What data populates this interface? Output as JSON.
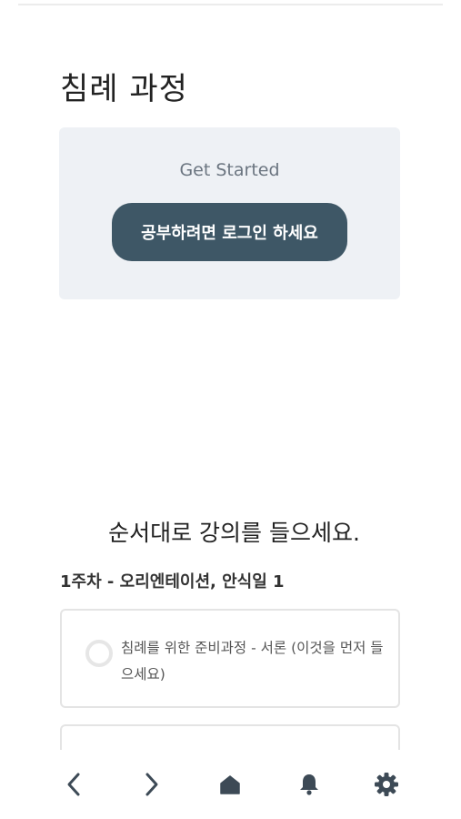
{
  "course": {
    "title": "침례 과정"
  },
  "cta": {
    "heading": "Get Started",
    "button_label": "공부하려면 로그인 하세요"
  },
  "instructions": "순서대로 강의를 들으세요.",
  "week": {
    "title": "1주차 - 오리엔테이션, 안식일 1",
    "lessons": [
      {
        "title": "침례를 위한 준비과정 - 서론 (이것을 먼저 들으세요)",
        "completed": false
      }
    ]
  },
  "bottom_nav": {
    "items": [
      {
        "name": "back",
        "icon": "chevron-left-icon"
      },
      {
        "name": "forward",
        "icon": "chevron-right-icon"
      },
      {
        "name": "home",
        "icon": "home-icon"
      },
      {
        "name": "notifications",
        "icon": "bell-icon"
      },
      {
        "name": "settings",
        "icon": "gear-icon"
      }
    ]
  },
  "colors": {
    "button_bg": "#3e5766",
    "card_bg": "#eef1f5",
    "icon": "#3d4a56"
  }
}
